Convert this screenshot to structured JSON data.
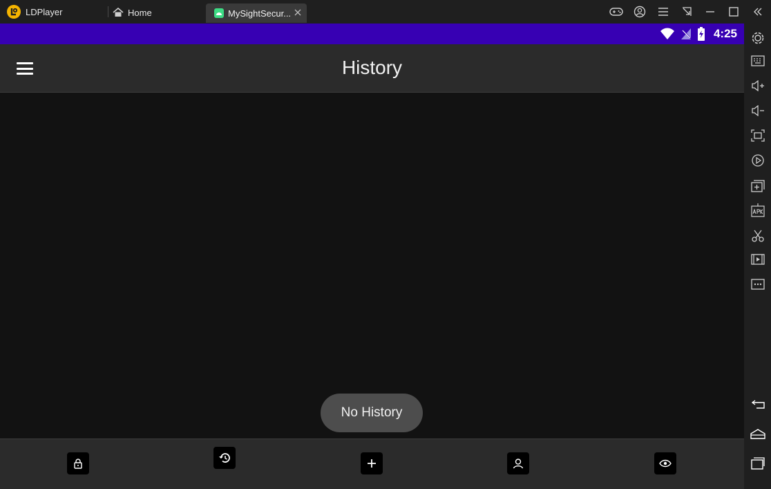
{
  "titlebar": {
    "app_name": "LDPlayer",
    "tabs": [
      {
        "label": "Home",
        "icon": "home-icon"
      },
      {
        "label": "MySightSecur...",
        "icon": "android-app-icon",
        "active": true
      }
    ],
    "window_controls": [
      "gamepad-icon",
      "account-icon",
      "menu-icon",
      "shrink-icon",
      "minimize-icon",
      "maximize-icon",
      "close-icon"
    ]
  },
  "statusbar": {
    "time": "4:25",
    "icons": [
      "wifi-icon",
      "no-signal-icon",
      "battery-charging-icon"
    ],
    "color": "#3700b3"
  },
  "appbar": {
    "title": "History",
    "menu_icon": "hamburger-menu-icon"
  },
  "content": {
    "toast": "No History"
  },
  "bottom_nav": {
    "items": [
      {
        "icon": "lock-icon"
      },
      {
        "icon": "history-icon",
        "selected": true
      },
      {
        "icon": "add-icon"
      },
      {
        "icon": "profile-icon"
      },
      {
        "icon": "eye-icon"
      }
    ]
  },
  "sidebar": {
    "icons": [
      "settings-icon",
      "keyboard-icon",
      "volume-up-icon",
      "volume-down-icon",
      "fullscreen-icon",
      "rotate-icon",
      "multi-instance-icon",
      "apk-install-icon",
      "scissors-icon",
      "record-video-icon",
      "more-icon",
      "back-icon",
      "home-nav-icon",
      "recents-icon"
    ]
  },
  "colors": {
    "accent": "#3700b3",
    "appbar": "#2b2b2b",
    "background": "#121212",
    "toast": "#4d4d4d",
    "brand": "#f5b400"
  }
}
